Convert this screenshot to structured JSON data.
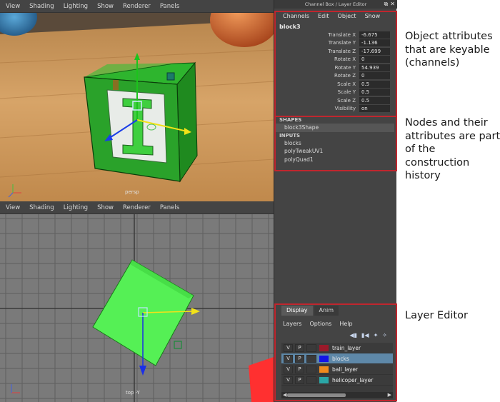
{
  "viewport_persp": {
    "menu": [
      "View",
      "Shading",
      "Lighting",
      "Show",
      "Renderer",
      "Panels"
    ],
    "camera_label": "persp"
  },
  "viewport_top": {
    "menu": [
      "View",
      "Shading",
      "Lighting",
      "Show",
      "Renderer",
      "Panels"
    ],
    "camera_label": "top -Y"
  },
  "panel": {
    "title": "Channel Box / Layer Editor"
  },
  "channel_box": {
    "menu": [
      "Channels",
      "Edit",
      "Object",
      "Show"
    ],
    "node_name": "block3",
    "attributes": [
      {
        "label": "Translate X",
        "value": "-6.675"
      },
      {
        "label": "Translate Y",
        "value": "-1.136"
      },
      {
        "label": "Translate Z",
        "value": "-17.699"
      },
      {
        "label": "Rotate X",
        "value": "0"
      },
      {
        "label": "Rotate Y",
        "value": "54.939"
      },
      {
        "label": "Rotate Z",
        "value": "0"
      },
      {
        "label": "Scale X",
        "value": "0.5"
      },
      {
        "label": "Scale Y",
        "value": "0.5"
      },
      {
        "label": "Scale Z",
        "value": "0.5"
      },
      {
        "label": "Visibility",
        "value": "on"
      }
    ]
  },
  "history": {
    "shapes_heading": "SHAPES",
    "shape_node": "block3Shape",
    "inputs_heading": "INPUTS",
    "inputs": [
      "blocks",
      "polyTweakUV1",
      "polyQuad1"
    ]
  },
  "layer_editor": {
    "tabs": [
      "Display",
      "Anim"
    ],
    "menu": [
      "Layers",
      "Options",
      "Help"
    ],
    "layers": [
      {
        "name": "train_layer",
        "color": "#9a1a2a",
        "selected": false,
        "v": "V",
        "p": "P"
      },
      {
        "name": "blocks",
        "color": "#1414e6",
        "selected": true,
        "v": "V",
        "p": "P"
      },
      {
        "name": "ball_layer",
        "color": "#f08a1c",
        "selected": false,
        "v": "V",
        "p": "P"
      },
      {
        "name": "helicoper_layer",
        "color": "#2aa6a6",
        "selected": false,
        "v": "V",
        "p": "P"
      }
    ]
  },
  "annotations": {
    "channels": "Object attributes that are keyable (channels)",
    "history": "Nodes and their attributes are part of the construction history",
    "layer_editor": "Layer Editor"
  },
  "colors": {
    "highlight": "#c0262e",
    "block_green": "#2ea32e",
    "top_view_green": "#55f055"
  }
}
